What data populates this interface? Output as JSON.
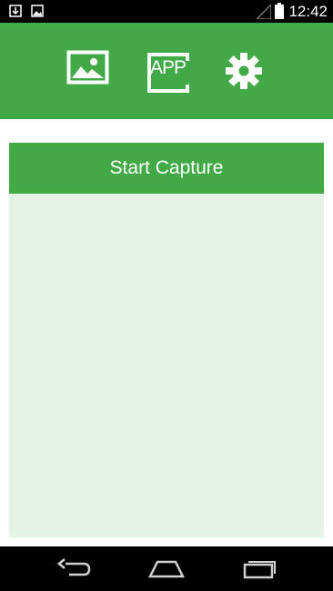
{
  "status_bar": {
    "time": "12:42",
    "left_icons": [
      "download-icon",
      "image-icon"
    ],
    "right_icons": [
      "signal-icon",
      "battery-icon"
    ]
  },
  "toolbar": {
    "background_color": "#41a946",
    "items": [
      {
        "icon": "gallery-icon"
      },
      {
        "icon": "app-icon",
        "label": "APP"
      },
      {
        "icon": "settings-icon"
      }
    ]
  },
  "main": {
    "start_button_label": "Start Capture",
    "button_color": "#41a946",
    "panel_color": "#e5f3e6"
  },
  "nav_bar": {
    "items": [
      "back-icon",
      "home-icon",
      "recents-icon"
    ]
  }
}
